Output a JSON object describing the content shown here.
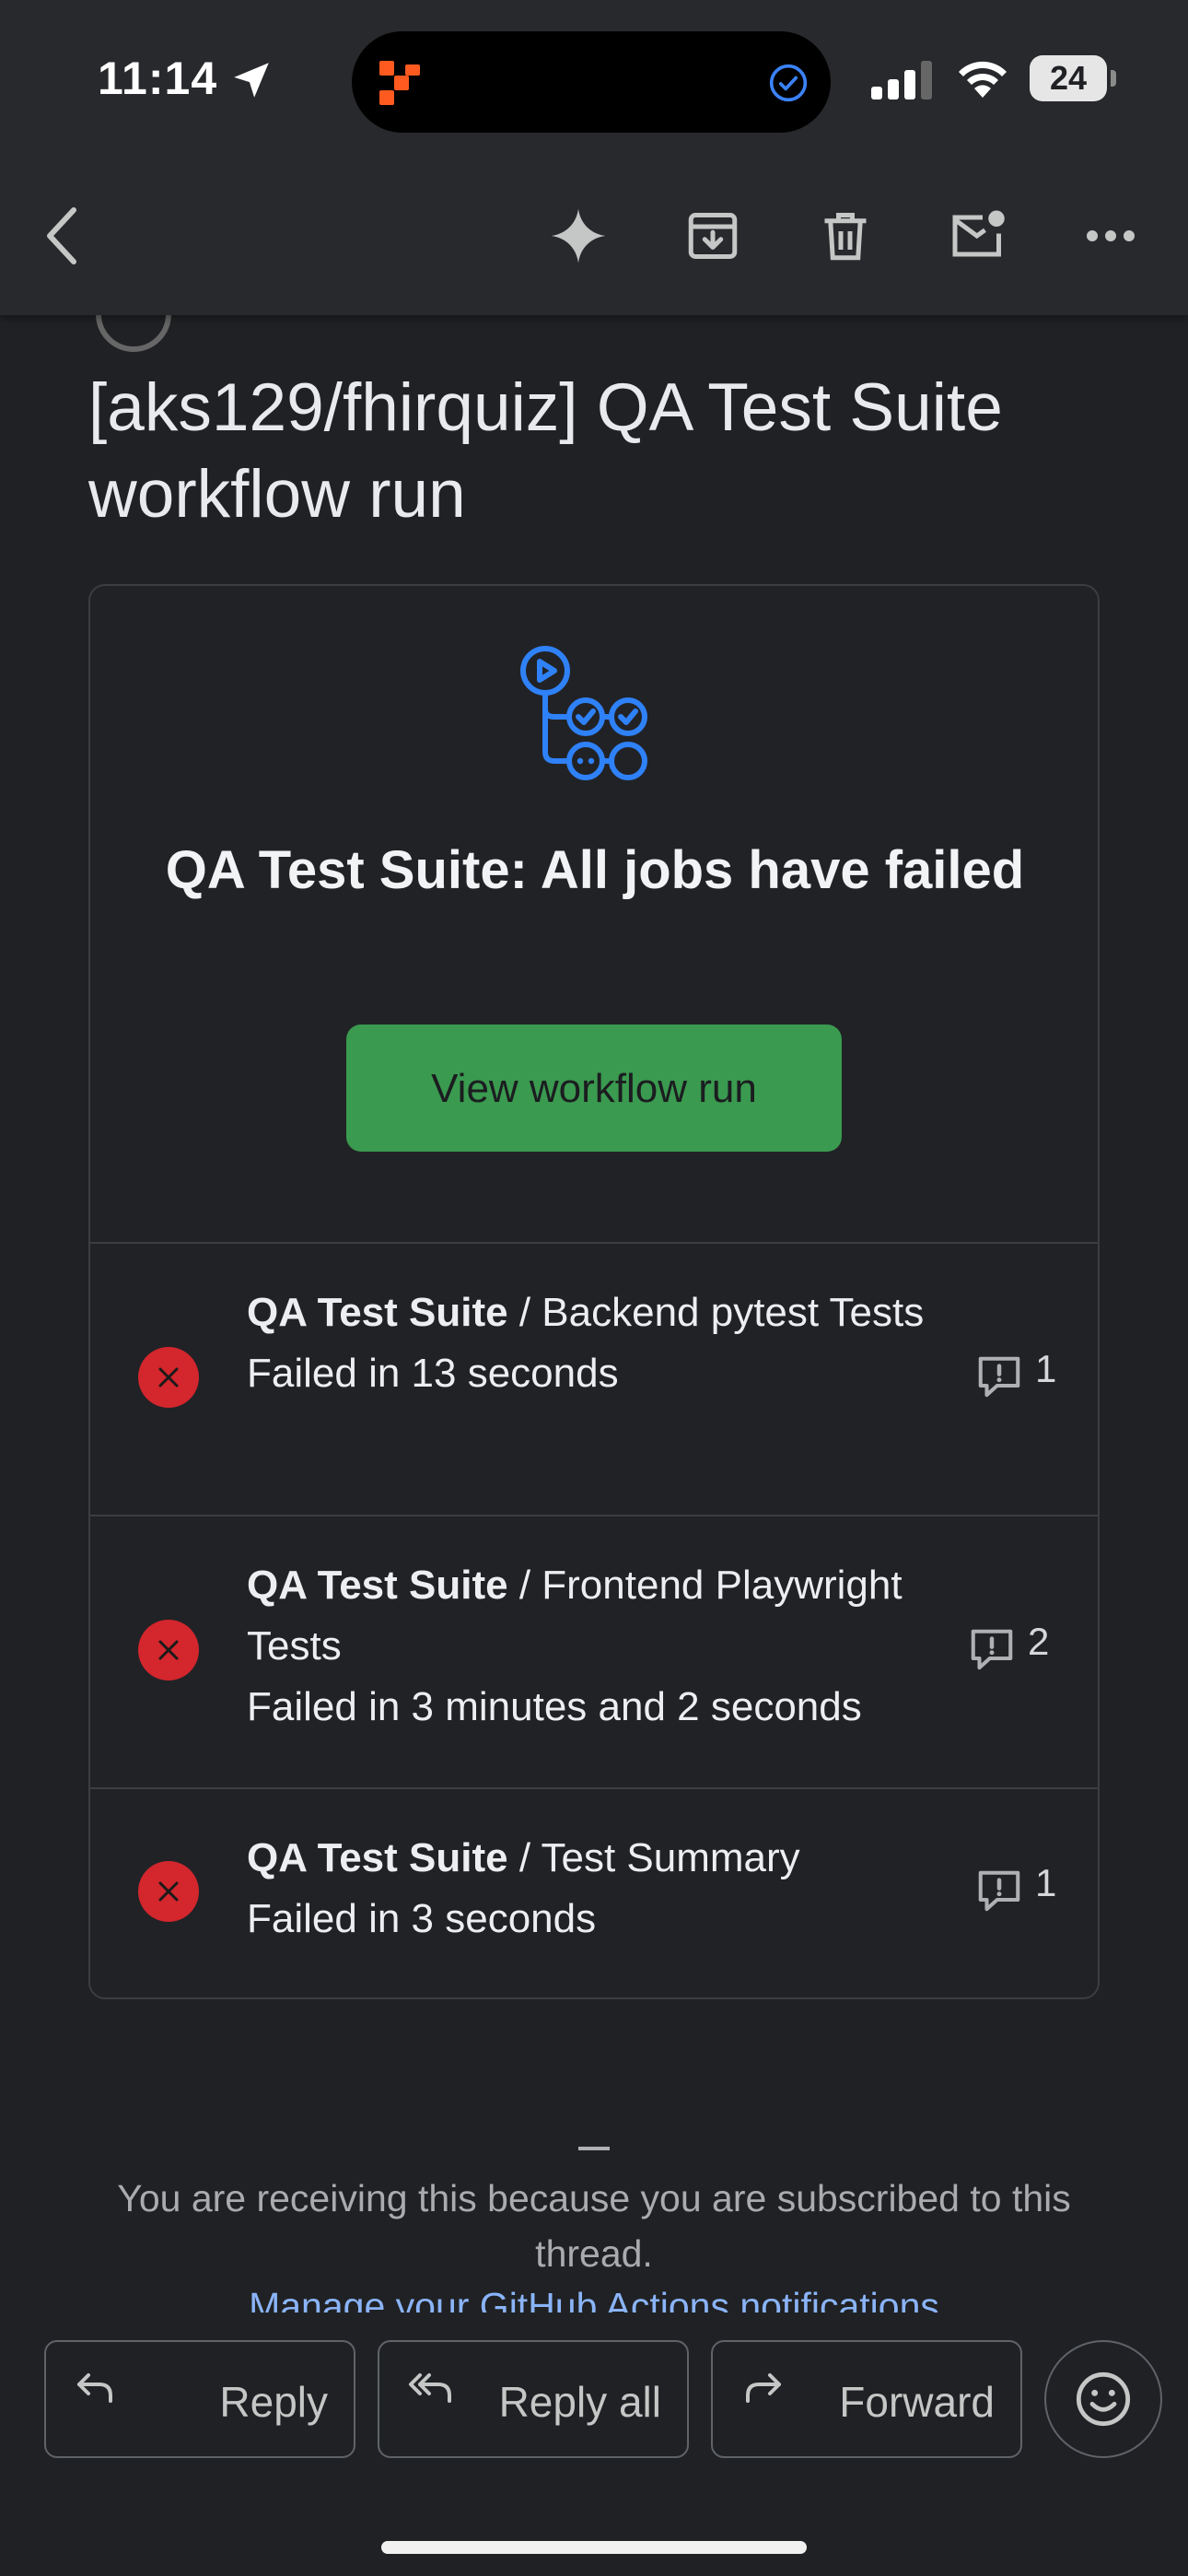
{
  "status_bar": {
    "time": "11:14",
    "battery": "24"
  },
  "toolbar": {
    "icons": [
      "back-arrow-icon",
      "sparkle-icon",
      "archive-icon",
      "trash-icon",
      "mark-unread-icon",
      "more-icon"
    ]
  },
  "email": {
    "subject": "[aks129/fhirquiz] QA Test Suite workflow run",
    "card": {
      "title": "QA Test Suite: All jobs have failed",
      "button_label": "View workflow run",
      "button_color": "#3a9a4f"
    },
    "jobs": [
      {
        "workflow": "QA Test Suite",
        "separator": " / ",
        "job": "Backend pytest Tests",
        "status": "Failed in 13 seconds",
        "annotations": "1"
      },
      {
        "workflow": "QA Test Suite",
        "separator": " / ",
        "job": "Frontend Playwright Tests",
        "status": "Failed in 3 minutes and 2 seconds",
        "annotations": "2"
      },
      {
        "workflow": "QA Test Suite",
        "separator": " / ",
        "job": "Test Summary",
        "status": "Failed in 3 seconds",
        "annotations": "1"
      }
    ],
    "footer": {
      "dash": "—",
      "notice": "You are receiving this because you are subscribed to this thread.",
      "link": "Manage your GitHub Actions notifications"
    }
  },
  "actions": {
    "reply": "Reply",
    "reply_all": "Reply all",
    "forward": "Forward"
  },
  "colors": {
    "background": "#202124",
    "failure": "#d3262d",
    "link": "#8ab4f8",
    "workflow_icon": "#2f81f7"
  }
}
